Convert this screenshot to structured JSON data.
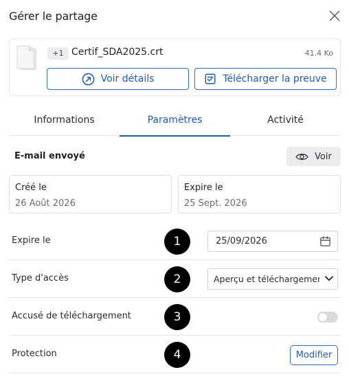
{
  "header": {
    "title": "Gérer le partage"
  },
  "file": {
    "count_badge": "+1",
    "name": "Certif_SDA2025.crt",
    "size": "41.4 Ko",
    "details_label": "Voir détails",
    "proof_label": "Télécharger la preuve"
  },
  "tabs": [
    {
      "label": "Informations",
      "active": false
    },
    {
      "label": "Paramètres",
      "active": true
    },
    {
      "label": "Activité",
      "active": false
    }
  ],
  "email": {
    "label": "E-mail envoyé",
    "view_label": "Voir"
  },
  "dates": {
    "created_label": "Créé le",
    "created_value": "26 Août 2026",
    "expires_label": "Expire le",
    "expires_value": "25 Sept. 2026"
  },
  "settings": {
    "expire": {
      "label": "Expire le",
      "marker": "1",
      "value": "25/09/2026"
    },
    "access": {
      "label": "Type d'accès",
      "marker": "2",
      "value": "Aperçu et téléchargement"
    },
    "receipt": {
      "label": "Accusé de téléchargement",
      "marker": "3",
      "enabled": false
    },
    "protection": {
      "label": "Protection",
      "marker": "4",
      "button_label": "Modifier"
    }
  },
  "colors": {
    "accent": "#1e5bb0",
    "tab_border": "#e6e6ec",
    "toggle_off": "#d9d9de",
    "marker": "#000000"
  }
}
